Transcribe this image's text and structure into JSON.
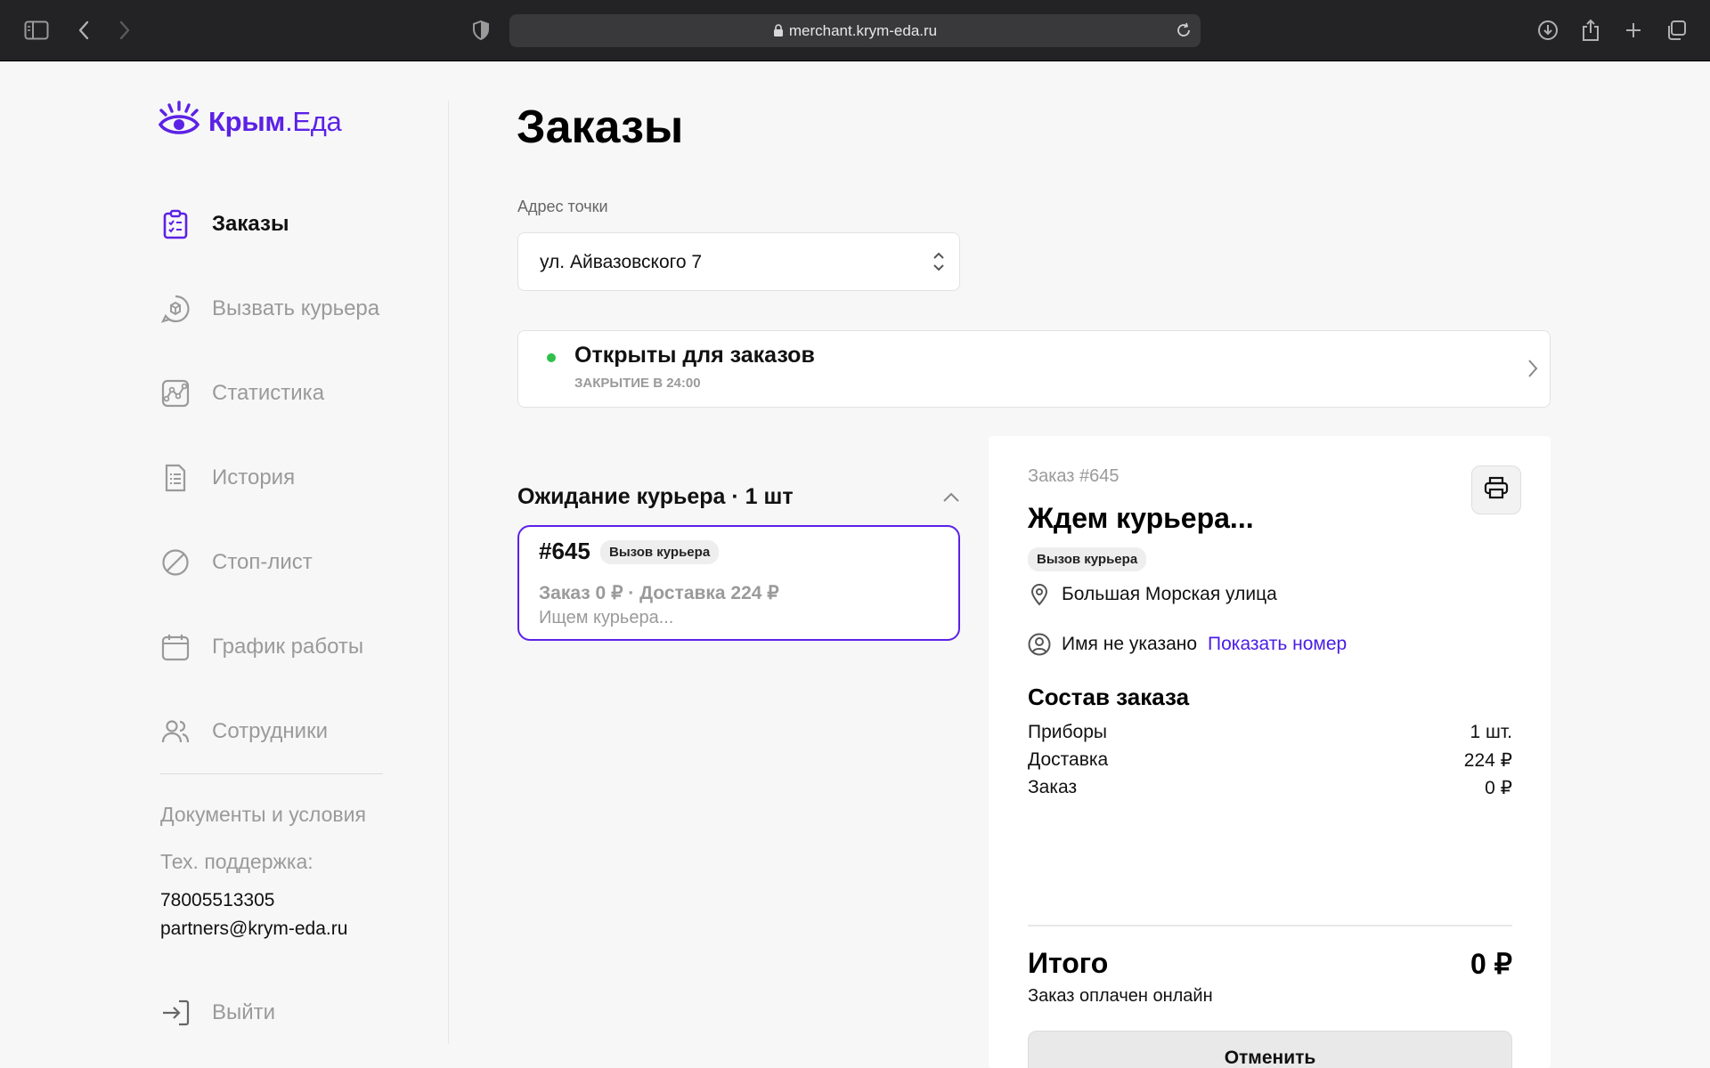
{
  "browser": {
    "url": "merchant.krym-eda.ru"
  },
  "brand": {
    "name_part1": "Крым",
    "name_part2": ".Еда",
    "accent": "#5b21e6"
  },
  "sidebar": {
    "items": [
      {
        "label": "Заказы",
        "icon": "clipboard-icon",
        "active": true
      },
      {
        "label": "Вызвать курьера",
        "icon": "courier-chat-icon",
        "active": false
      },
      {
        "label": "Статистика",
        "icon": "chart-icon",
        "active": false
      },
      {
        "label": "История",
        "icon": "document-icon",
        "active": false
      },
      {
        "label": "Стоп-лист",
        "icon": "prohibited-icon",
        "active": false
      },
      {
        "label": "График работы",
        "icon": "calendar-icon",
        "active": false
      },
      {
        "label": "Сотрудники",
        "icon": "users-icon",
        "active": false
      }
    ],
    "docs_label": "Документы и условия",
    "support_label": "Тех. поддержка:",
    "support_phone": "78005513305",
    "support_email": "partners@krym-eda.ru",
    "logout_label": "Выйти"
  },
  "main": {
    "title": "Заказы",
    "point_label": "Адрес точки",
    "point_value": "ул. Айвазовского 7",
    "status": {
      "title": "Открыты для заказов",
      "subtitle": "ЗАКРЫТИЕ В 24:00",
      "color": "#2ec04a"
    },
    "group": {
      "title": "Ожидание курьера · 1 шт",
      "orders": [
        {
          "number": "#645",
          "badge": "Вызов курьера",
          "summary": "Заказ 0 ₽ · Доставка 224 ₽",
          "state": "Ищем курьера..."
        }
      ]
    }
  },
  "detail": {
    "order_label": "Заказ #645",
    "title": "Ждем курьера...",
    "badge": "Вызов курьера",
    "address": "Большая Морская улица",
    "customer_name": "Имя не указано",
    "show_phone": "Показать номер",
    "composition_title": "Состав заказа",
    "items": [
      {
        "name": "Приборы",
        "value": "1 шт."
      },
      {
        "name": "Доставка",
        "value": "224 ₽"
      },
      {
        "name": "Заказ",
        "value": "0 ₽"
      }
    ],
    "total_label": "Итого",
    "total_value": "0 ₽",
    "payment_note": "Заказ оплачен онлайн",
    "cancel_label": "Отменить"
  }
}
